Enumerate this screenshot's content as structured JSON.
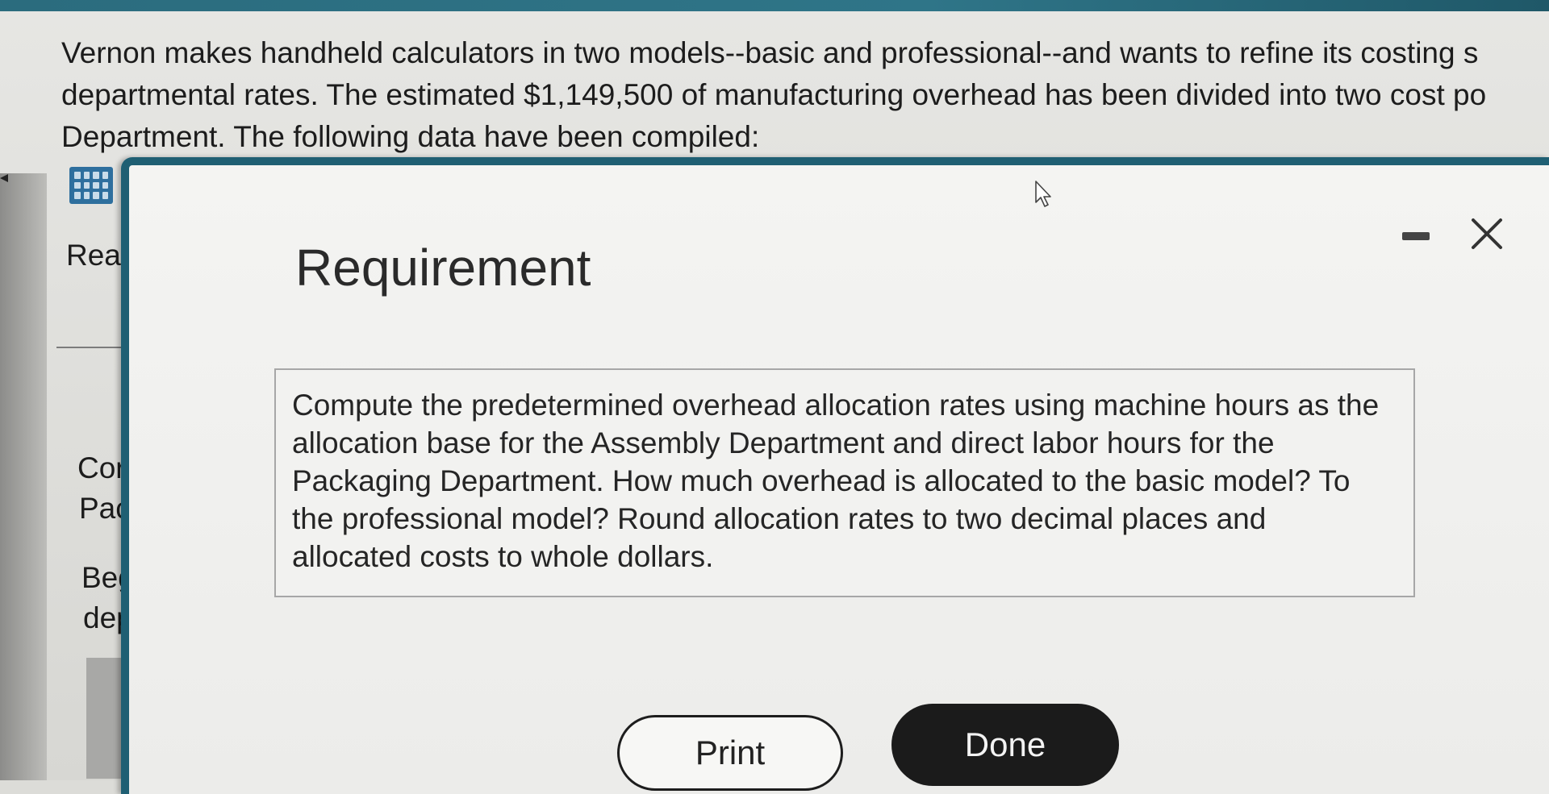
{
  "question": {
    "lines": [
      "Vernon makes handheld calculators in two models--basic and professional--and wants to refine its costing s",
      "departmental rates. The estimated $1,149,500 of manufacturing overhead has been divided into two cost po",
      "Department. The following data have been compiled:"
    ]
  },
  "background_fragments": {
    "rea": "Rea",
    "cor": "Cor",
    "pac": "Pac",
    "beg": "Beg",
    "dep": "dep"
  },
  "dialog": {
    "title": "Requirement",
    "requirement_lines": [
      "Compute the predetermined overhead allocation rates using machine hours as the",
      "allocation base for the Assembly Department and direct labor hours for the",
      "Packaging Department. How much overhead is allocated to the basic model? To",
      "the professional model? Round allocation rates to two decimal places and",
      "allocated costs to whole dollars."
    ],
    "print_label": "Print",
    "done_label": "Done",
    "minimize_icon": "minimize-icon",
    "close_icon": "close-icon"
  },
  "colors": {
    "dialog_border": "#1f5f73",
    "done_button_bg": "#1b1b1b",
    "data_icon": "#2e6f9e"
  }
}
